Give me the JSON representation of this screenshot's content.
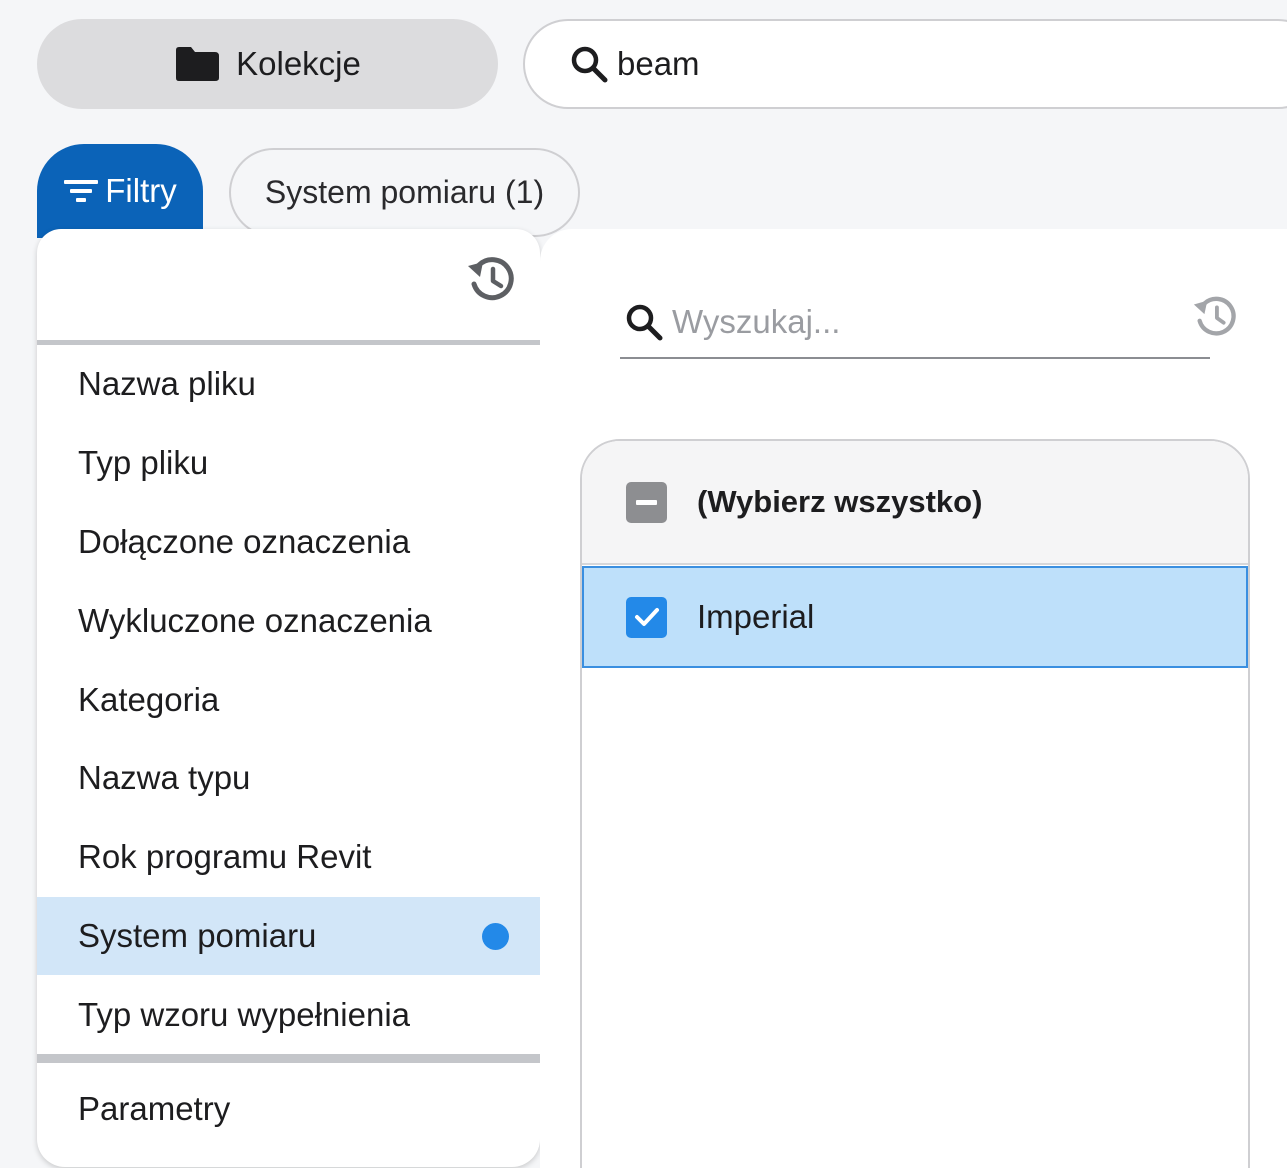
{
  "header": {
    "collections_label": "Kolekcje",
    "search_value": "beam"
  },
  "filters": {
    "filters_label": "Filtry",
    "active_chip_label": "System pomiaru (1)"
  },
  "filter_menu": {
    "items": [
      {
        "label": "Nazwa pliku"
      },
      {
        "label": "Typ pliku"
      },
      {
        "label": "Dołączone oznaczenia"
      },
      {
        "label": "Wykluczone oznaczenia"
      },
      {
        "label": "Kategoria"
      },
      {
        "label": "Nazwa typu"
      },
      {
        "label": "Rok programu Revit"
      },
      {
        "label": "System pomiaru",
        "active": true
      },
      {
        "label": "Typ wzoru wypełnienia"
      }
    ],
    "extra_item": "Parametry"
  },
  "value_panel": {
    "search_placeholder": "Wyszukaj...",
    "select_all_label": "(Wybierz wszystko)",
    "options": [
      {
        "label": "Imperial",
        "checked": true
      }
    ]
  },
  "colors": {
    "accent": "#0b63b8",
    "selected_row": "#bee0fa",
    "active_menu": "#d2e6f8",
    "dot": "#2389e8"
  },
  "icons": [
    "folder-icon",
    "search-icon",
    "filter-icon",
    "history-icon",
    "checkbox-indeterminate-icon",
    "checkmark-icon"
  ]
}
